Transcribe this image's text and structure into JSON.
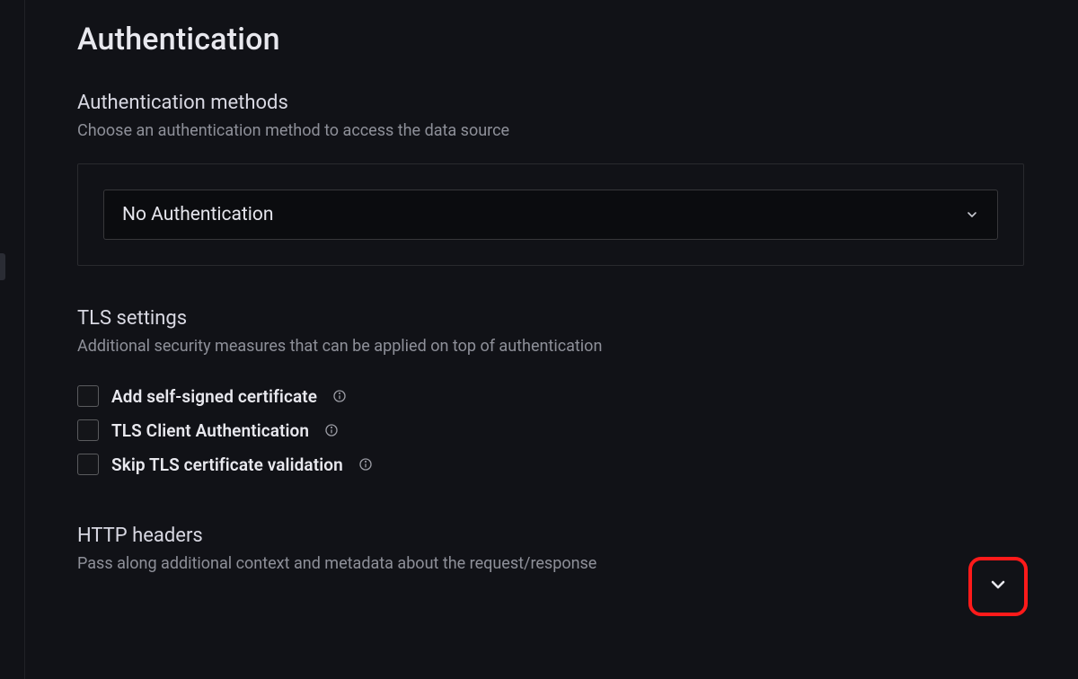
{
  "section": {
    "title": "Authentication"
  },
  "auth_methods": {
    "title": "Authentication methods",
    "description": "Choose an authentication method to access the data source",
    "selected": "No Authentication"
  },
  "tls": {
    "title": "TLS settings",
    "description": "Additional security measures that can be applied on top of authentication",
    "options": [
      {
        "label": "Add self-signed certificate",
        "checked": false
      },
      {
        "label": "TLS Client Authentication",
        "checked": false
      },
      {
        "label": "Skip TLS certificate validation",
        "checked": false
      }
    ]
  },
  "http_headers": {
    "title": "HTTP headers",
    "description": "Pass along additional context and metadata about the request/response"
  }
}
